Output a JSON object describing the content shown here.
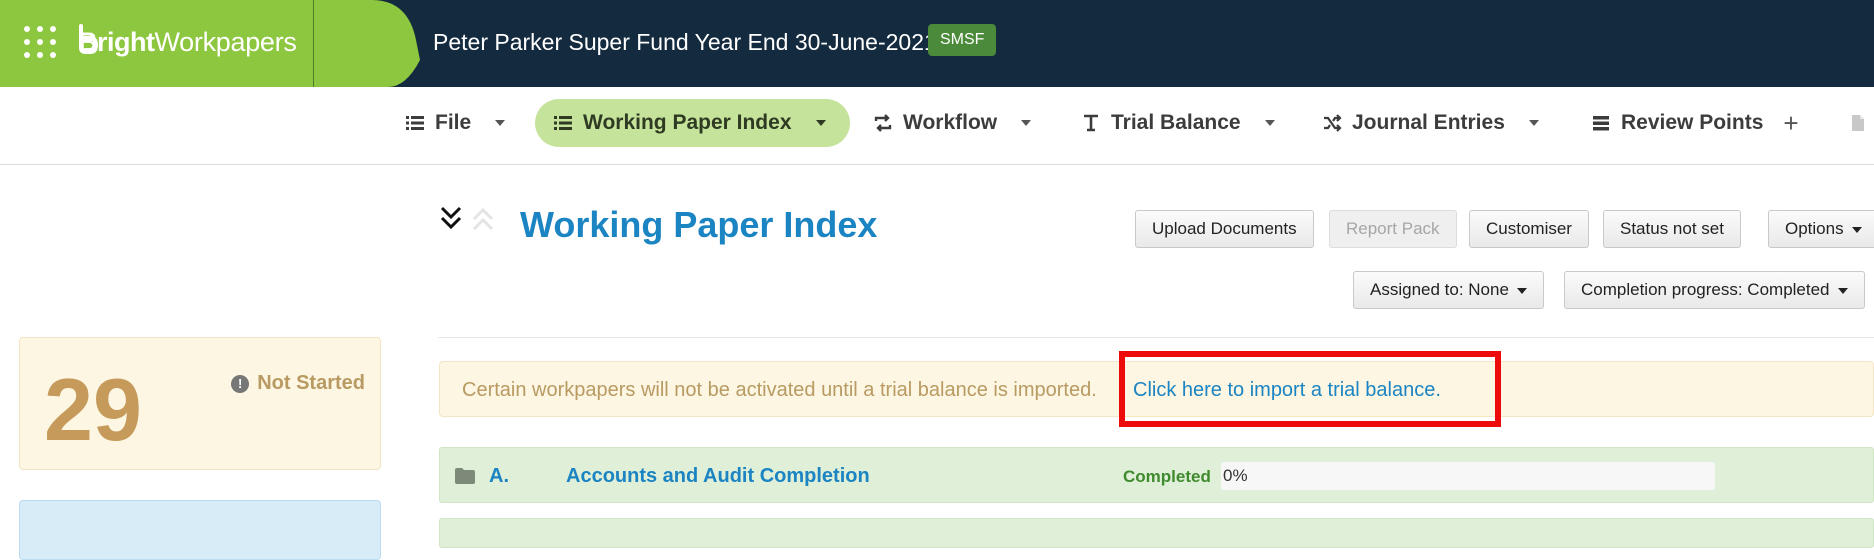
{
  "header": {
    "brand_bold": "Bright",
    "brand_light": "Workpapers",
    "title": "Peter Parker Super Fund Year End 30-June-2021",
    "badge": "SMSF",
    "colors": {
      "header_bg": "#132a3f",
      "brand_green": "#8dc63f"
    }
  },
  "nav": {
    "items": [
      {
        "label": "File",
        "icon": "list-icon"
      },
      {
        "label": "Working Paper Index",
        "icon": "list-icon",
        "active": true
      },
      {
        "label": "Workflow",
        "icon": "workflow-icon"
      },
      {
        "label": "Trial Balance",
        "icon": "text-icon"
      },
      {
        "label": "Journal Entries",
        "icon": "shuffle-icon"
      },
      {
        "label": "Review Points",
        "icon": "stack-icon"
      }
    ]
  },
  "stats": {
    "count": "29",
    "status": "Not Started"
  },
  "main": {
    "title": "Working Paper Index",
    "buttons": {
      "upload": "Upload Documents",
      "report_pack": "Report Pack",
      "customiser": "Customiser",
      "status": "Status not set",
      "options": "Options",
      "assigned": "Assigned to: None",
      "completion": "Completion progress: Completed"
    }
  },
  "alert": {
    "text": "Certain workpapers will not be activated until a trial balance is imported.",
    "link": "Click here to import a trial balance."
  },
  "sections": [
    {
      "code": "A.",
      "title": "Accounts and Audit Completion",
      "status": "Completed",
      "progress_text": "0%",
      "progress": 0
    }
  ]
}
